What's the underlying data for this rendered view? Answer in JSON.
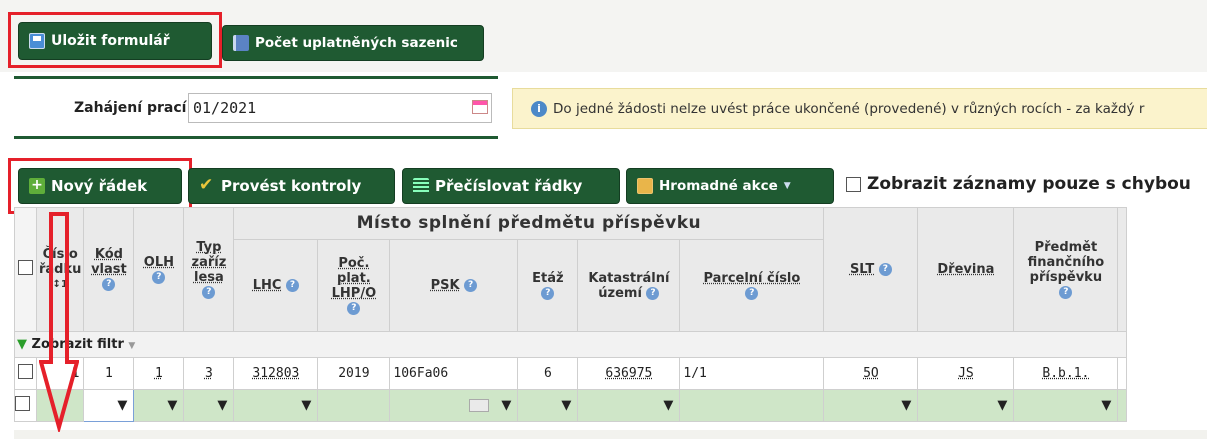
{
  "toolbar": {
    "save_label": "Uložit formulář",
    "count_label": "Počet uplatněných sazenic"
  },
  "form": {
    "start_label": "Zahájení prací",
    "start_value": "01/2021"
  },
  "info": {
    "text": "Do jedné žádosti nelze uvést práce ukončené (provedené) v různých rocích - za každý r"
  },
  "grid_toolbar": {
    "new_row": "Nový řádek",
    "run_checks": "Provést kontroly",
    "renumber": "Přečíslovat řádky",
    "bulk_actions": "Hromadné akce",
    "only_errors": "Zobrazit záznamy pouze s chybou"
  },
  "table": {
    "group_header": "Místo splnění předmětu příspěvku",
    "headers": {
      "row_no_1": "Číslo",
      "row_no_2": "řádku",
      "row_no_sort": "↕1",
      "kod_1": "Kód",
      "kod_2": "vlast",
      "olh": "OLH",
      "typ_1": "Typ",
      "typ_2": "zaříz",
      "typ_3": "lesa",
      "lhc": "LHC",
      "poc_1": "Poč.",
      "poc_2": "plat.",
      "poc_3": "LHP/O",
      "psk": "PSK",
      "etaz": "Etáž",
      "kat_1": "Katastrální",
      "kat_2": "území",
      "parc": "Parcelní číslo",
      "slt": "SLT",
      "drevina": "Dřevina",
      "pred_1": "Předmět",
      "pred_2": "finančního",
      "pred_3": "příspěvku"
    },
    "filter_label": "Zobrazit filtr",
    "row": {
      "cislo": "1",
      "kod": "1",
      "olh": "1",
      "typ": "3",
      "lhc": "312803",
      "poc": "2019",
      "psk": "106Fa06",
      "etaz": "6",
      "kat": "636975",
      "parc": "1/1",
      "slt": "5O",
      "drevina": "JS",
      "predmet": "B.b.1."
    }
  },
  "colors": {
    "button_green": "#1f5a32",
    "highlight_red": "#e5202a",
    "edit_row_green": "#cfe6c8",
    "info_bg": "#fbf3cc"
  }
}
